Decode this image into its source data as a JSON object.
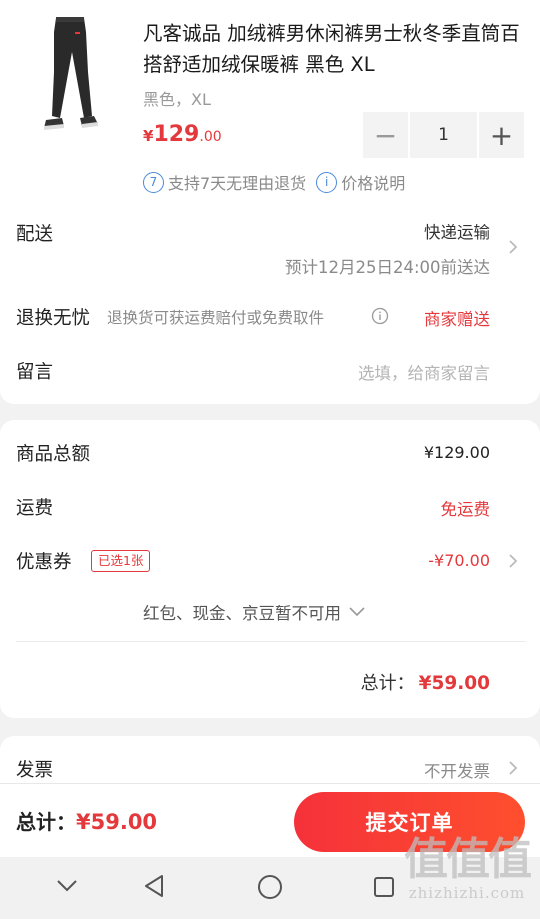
{
  "product": {
    "title": "凡客诚品 加绒裤男休闲裤男士秋冬季直筒百搭舒适加绒保暖裤 黑色 XL",
    "spec": "黑色，XL",
    "price_currency": "¥",
    "price_int": "129",
    "price_dec": ".00",
    "quantity": "1",
    "minus_label": "−",
    "plus_label": "+",
    "service_icon_num": "7",
    "service_return": "支持7天无理由退货",
    "service_icon_info": "i",
    "service_price_note": "价格说明"
  },
  "delivery": {
    "label": "配送",
    "method": "快递运输",
    "eta": "预计12月25日24:00前送达"
  },
  "return_worry": {
    "label": "退换无忧",
    "desc": "退换货可获运费赔付或免费取件",
    "value": "商家赠送"
  },
  "message": {
    "label": "留言",
    "placeholder": "选填，给商家留言"
  },
  "summary": {
    "goods_total_label": "商品总额",
    "goods_total_value": "¥129.00",
    "shipping_label": "运费",
    "shipping_value": "免运费",
    "coupon_label": "优惠券",
    "coupon_badge": "已选1张",
    "coupon_value": "-¥70.00",
    "other_unavailable": "红包、现金、京豆暂不可用",
    "total_label": "总计：",
    "total_value": "¥59.00"
  },
  "invoice": {
    "label": "发票",
    "value": "不开发票"
  },
  "bottom_bar": {
    "total_label": "总计：",
    "total_value": "¥59.00",
    "submit_label": "提交订单"
  },
  "watermark": {
    "logo": "值值值",
    "site": "zhizhizhi.com"
  },
  "colors": {
    "accent_red": "#e4393c",
    "submit_gradient_start": "#f5313a",
    "submit_gradient_end": "#fe4f2e",
    "info_blue": "#4a8ad8"
  }
}
